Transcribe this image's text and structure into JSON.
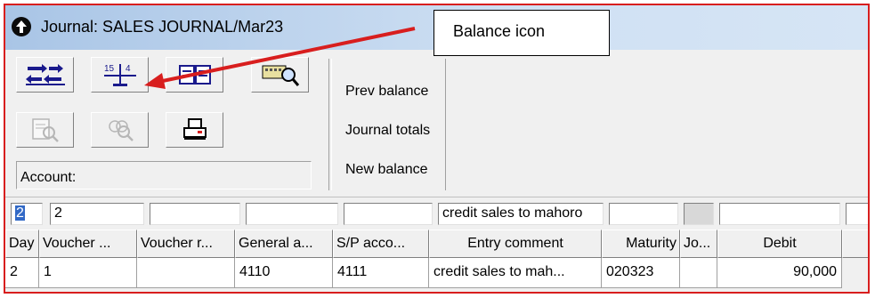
{
  "window": {
    "title": "Journal: SALES JOURNAL/Mar23"
  },
  "toolbar": {
    "buttons": [
      {
        "id": "transfer",
        "icon": "transfer-arrows-icon"
      },
      {
        "id": "balance",
        "icon": "balance-scale-icon"
      },
      {
        "id": "book",
        "icon": "open-book-icon"
      },
      {
        "id": "keyboard-search",
        "icon": "keyboard-search-icon"
      },
      {
        "id": "document-search",
        "icon": "document-search-icon",
        "disabled": true
      },
      {
        "id": "people-search",
        "icon": "people-search-icon",
        "disabled": true
      },
      {
        "id": "print",
        "icon": "printer-icon"
      }
    ],
    "account_label": "Account:"
  },
  "summary": {
    "prev_balance": "Prev balance",
    "journal_totals": "Journal totals",
    "new_balance": "New balance"
  },
  "entry": {
    "day_selected": "2",
    "voucher": "2",
    "voucher_ref": "",
    "general_account": "",
    "sp_account": "",
    "comment": "credit sales to mahoro",
    "maturity": "",
    "jo": "",
    "debit": "",
    "extra": ""
  },
  "grid": {
    "columns": [
      "Day",
      "Voucher ...",
      "Voucher r...",
      "General a...",
      "S/P acco...",
      "Entry comment",
      "Maturity",
      "Jo...",
      "Debit"
    ],
    "rows": [
      [
        "2",
        "1",
        "",
        "4110",
        "4111",
        "credit sales to mah...",
        "020323",
        "",
        "90,000"
      ]
    ]
  },
  "annotation": {
    "callout_text": "Balance icon",
    "arrow_color": "#d81e1e"
  }
}
